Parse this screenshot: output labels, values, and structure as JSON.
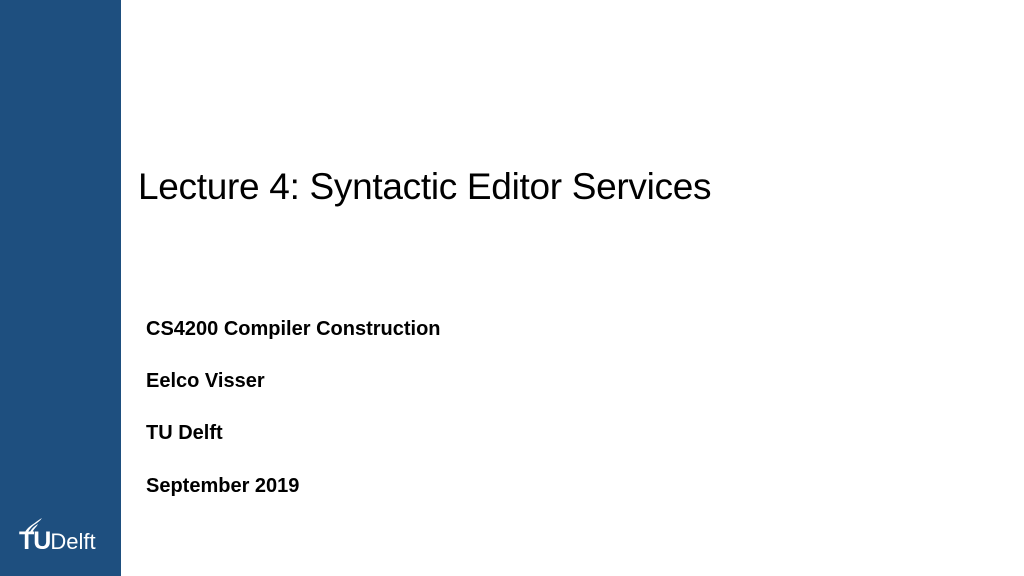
{
  "slide": {
    "title": "Lecture 4: Syntactic Editor Services",
    "course": "CS4200 Compiler Construction",
    "author": "Eelco Visser",
    "affiliation": "TU Delft",
    "date": "September 2019"
  },
  "logo": {
    "icon": "flame-icon",
    "part1": "TU",
    "part2": "Delft"
  },
  "colors": {
    "sidebar": "#1e4f7f",
    "text": "#000000",
    "logo_text": "#ffffff"
  }
}
